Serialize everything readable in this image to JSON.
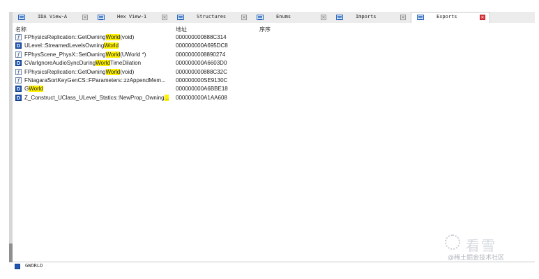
{
  "tabs": [
    {
      "label": "IDA View-A",
      "icon": "disassembly-view-icon",
      "active": false
    },
    {
      "label": "Hex View-1",
      "icon": "hex-view-icon",
      "active": false
    },
    {
      "label": "Structures",
      "icon": "structures-icon",
      "active": false
    },
    {
      "label": "Enums",
      "icon": "enums-icon",
      "active": false
    },
    {
      "label": "Imports",
      "icon": "imports-icon",
      "active": false
    },
    {
      "label": "Exports",
      "icon": "exports-icon",
      "active": true
    }
  ],
  "columns": {
    "name": "名称",
    "address": "地址",
    "ordinal": "序序"
  },
  "highlight_term": "World",
  "rows": [
    {
      "type": "f",
      "pre": "FPhysicsReplication::GetOwning",
      "match": "World",
      "post": "(void)",
      "address": "000000000888C314"
    },
    {
      "type": "d",
      "pre": "ULevel::StreamedLevelsOwning",
      "match": "World",
      "post": "",
      "address": "000000000A695DC8"
    },
    {
      "type": "f",
      "pre": "FPhysScene_PhysX::SetOwning",
      "match": "World",
      "post": "(UWorld *)",
      "address": "0000000008890274"
    },
    {
      "type": "d",
      "pre": "CVarIgnoreAudioSyncDuring",
      "match": "World",
      "post": "TimeDilation",
      "address": "000000000A6603D0"
    },
    {
      "type": "f",
      "pre": "FPhysicsReplication::GetOwning",
      "match": "World",
      "post": "(void)",
      "address": "000000000888C32C"
    },
    {
      "type": "f",
      "pre": "FNiagaraSortKeyGenCS::FParameters::zzAppendMem...",
      "match": "",
      "post": "",
      "address": "000000000SE9130C"
    },
    {
      "type": "d",
      "pre": "G",
      "match": "World",
      "post": "",
      "address": "000000000A6BBE18"
    },
    {
      "type": "d",
      "pre": "Z_Construct_UClass_ULevel_Statics::NewProp_Owning",
      "match": "...",
      "post": "",
      "address": "000000000A1AA608"
    }
  ],
  "status": {
    "text": "GWORLD"
  },
  "watermark": {
    "big": "看雪",
    "small": "@稀土掘金技术社区"
  }
}
